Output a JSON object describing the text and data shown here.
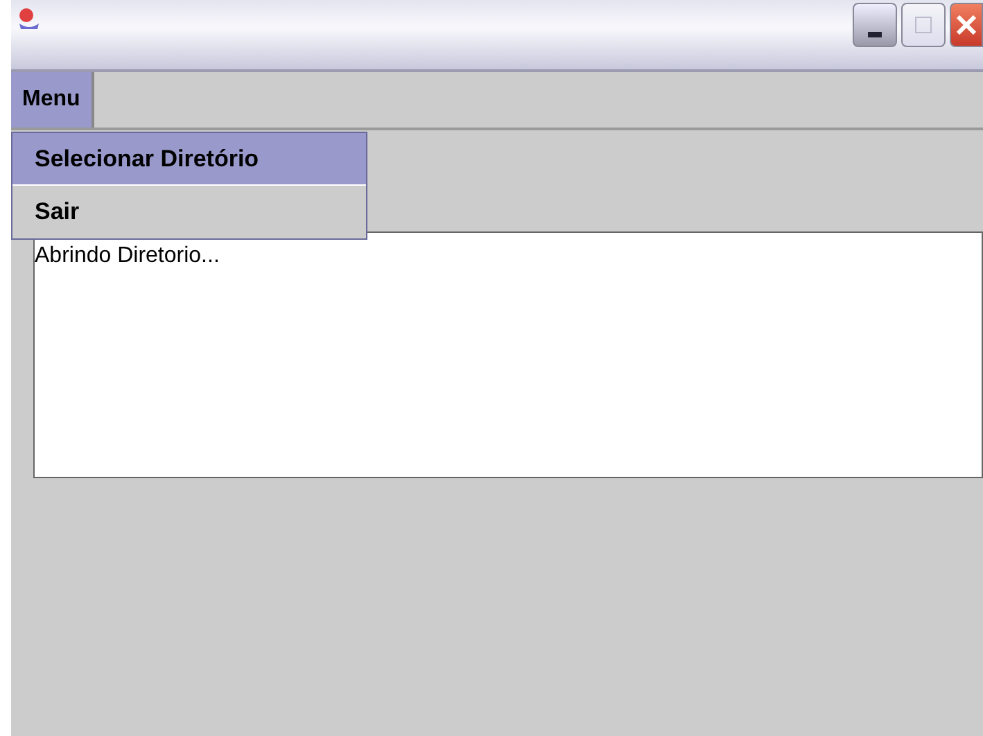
{
  "menu_bar": [
    {
      "label": "Menu",
      "selected": true
    }
  ],
  "dropdown": [
    {
      "label": "Selecionar Diretório",
      "selected": true
    },
    {
      "label": "Sair",
      "selected": false
    }
  ],
  "log": {
    "text": "Abrindo Diretorio..."
  }
}
